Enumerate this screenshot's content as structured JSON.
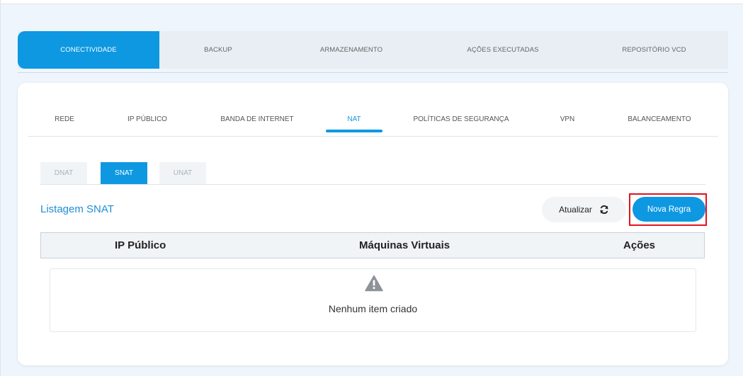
{
  "top_tabs": [
    {
      "label": "CONECTIVIDADE",
      "active": true
    },
    {
      "label": "BACKUP",
      "active": false
    },
    {
      "label": "ARMAZENAMENTO",
      "active": false
    },
    {
      "label": "AÇÕES EXECUTADAS",
      "active": false
    },
    {
      "label": "REPOSITÓRIO VCD",
      "active": false
    }
  ],
  "sub_tabs": [
    {
      "label": "REDE",
      "active": false
    },
    {
      "label": "IP PÚBLICO",
      "active": false
    },
    {
      "label": "BANDA DE INTERNET",
      "active": false
    },
    {
      "label": "NAT",
      "active": true
    },
    {
      "label": "POLÍTICAS DE SEGURANÇA",
      "active": false
    },
    {
      "label": "VPN",
      "active": false
    },
    {
      "label": "BALANCEAMENTO",
      "active": false
    }
  ],
  "nat_tabs": [
    {
      "label": "DNAT",
      "active": false
    },
    {
      "label": "SNAT",
      "active": true
    },
    {
      "label": "UNAT",
      "active": false
    }
  ],
  "list": {
    "title": "Listagem SNAT",
    "refresh_label": "Atualizar",
    "refresh_icon": "refresh-icon",
    "new_rule_label": "Nova Regra"
  },
  "table": {
    "columns": [
      "IP Público",
      "Máquinas Virtuais",
      "Ações"
    ],
    "empty_icon": "warning-icon",
    "empty_text": "Nenhum item criado"
  },
  "colors": {
    "accent": "#0e98e2",
    "highlight": "#e0141e",
    "background": "#eff5fc"
  }
}
